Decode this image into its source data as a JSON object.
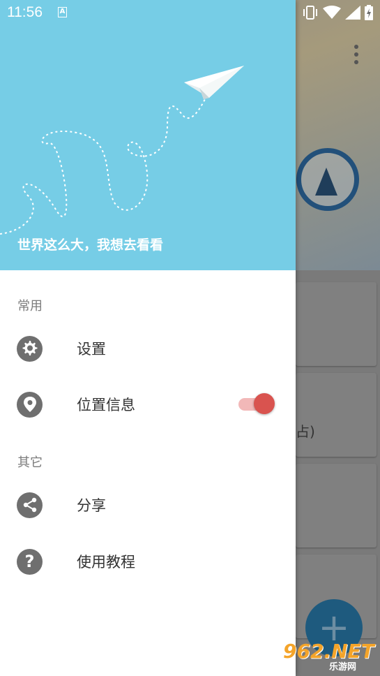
{
  "status_bar": {
    "time": "11:56",
    "notification_icon": "a-notification-icon",
    "icons": [
      "vibrate-icon",
      "wifi-icon",
      "signal-icon",
      "battery-charging-icon"
    ]
  },
  "drawer": {
    "header": {
      "slogan": "世界这么大，我想去看看",
      "background_color": "#76cde6",
      "illustration": "paper-plane-icon"
    },
    "sections": [
      {
        "label": "常用",
        "items": [
          {
            "label": "设置",
            "icon": "gear-icon"
          },
          {
            "label": "位置信息",
            "icon": "location-pin-icon",
            "toggle_on": true
          }
        ]
      },
      {
        "label": "其它",
        "items": [
          {
            "label": "分享",
            "icon": "share-icon"
          },
          {
            "label": "使用教程",
            "icon": "help-icon"
          }
        ]
      }
    ],
    "toggle_color": "#d9534f"
  },
  "background": {
    "card_partial_text": "占)",
    "fab_icon": "plus-icon"
  },
  "watermark": {
    "text": "962.NET",
    "sub": "乐游网"
  }
}
